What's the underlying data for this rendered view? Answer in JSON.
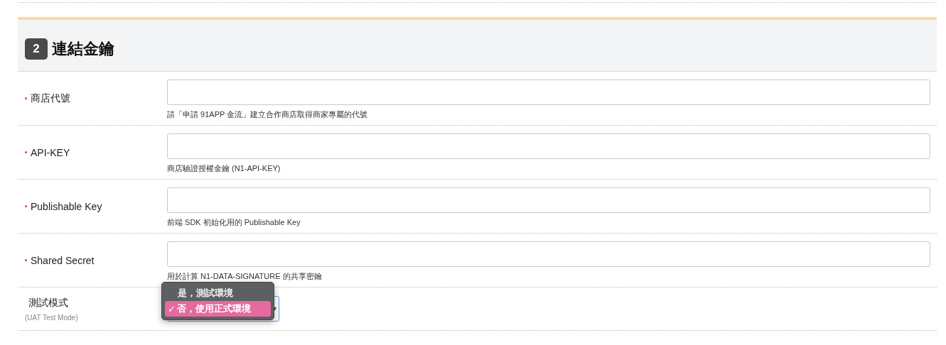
{
  "section": {
    "number": "2",
    "title": "連結金鑰"
  },
  "fields": [
    {
      "kind": "text",
      "label": "商店代號",
      "required": true,
      "hint": "請「申請 91APP 金流」建立合作商店取得商家專屬的代號"
    },
    {
      "kind": "text",
      "label": "API-KEY",
      "required": true,
      "hint": "商店驗證授權金鑰 (N1-API-KEY)"
    },
    {
      "kind": "text",
      "label": "Publishable Key",
      "required": true,
      "hint": "前端 SDK 初始化用的 Publishable Key"
    },
    {
      "kind": "text",
      "label": "Shared Secret",
      "required": true,
      "hint": "用於計算 N1-DATA-SIGNATURE 的共享密鑰"
    },
    {
      "kind": "select",
      "label": "測試模式",
      "sublabel": "(UAT Test Mode)",
      "required": false,
      "expanded": true,
      "check": "✓",
      "options": [
        {
          "label": "是，測試環境",
          "selected": false
        },
        {
          "label": "否，使用正式環境",
          "selected": true
        }
      ]
    }
  ]
}
